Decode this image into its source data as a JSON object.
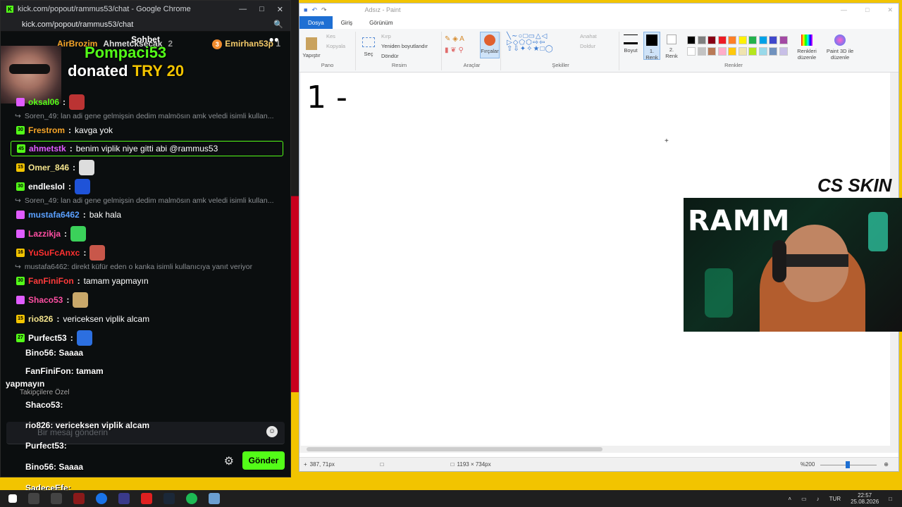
{
  "chrome": {
    "title": "kick.com/popout/rammus53/chat - Google Chrome",
    "url": "kick.com/popout/rammus53/chat"
  },
  "chat": {
    "header": "Sohbet",
    "pinned": [
      {
        "name": "AirBrozim"
      },
      {
        "name": "Ahmetcksecak",
        "count": "2"
      },
      {
        "name": "Emirhan53p",
        "count": "1",
        "rank": "3"
      }
    ],
    "donation": {
      "name": "Pompaci53",
      "text": "donated",
      "amount": "TRY 20",
      "mark": "!"
    },
    "messages": [
      {
        "type": "msg",
        "user": "oksal06",
        "text": "",
        "color": "#53fc18",
        "emote": "#b33"
      },
      {
        "type": "reply",
        "text": "Soren_49: lan adi gene gelmişsin dedim malmösın amk veledi isimli kullan..."
      },
      {
        "type": "msg",
        "lvl": "30",
        "user": "Frestrom",
        "text": "kavga yok",
        "color": "#f7a528"
      },
      {
        "type": "highlight",
        "lvl": "45",
        "user": "ahmetstk",
        "text": "benim viplik niye gitti abi @rammus53",
        "color": "#e05cff"
      },
      {
        "type": "msg",
        "lvl": "15",
        "user": "Omer_846",
        "text": "",
        "color": "#f3e38c",
        "emote": "#ddd"
      },
      {
        "type": "msg",
        "lvl": "30",
        "user": "endlesIol",
        "text": "",
        "color": "#ffffff",
        "emote": "#1f53d8"
      },
      {
        "type": "reply",
        "text": "Soren_49: lan adi gene gelmişsin dedim malmösın amk veledi isimli kullan..."
      },
      {
        "type": "msg",
        "lvl": "",
        "user": "mustafa6462",
        "text": "bak hala",
        "color": "#5aa0ff"
      },
      {
        "type": "msg",
        "lvl": "",
        "user": "Lazzikja",
        "text": "",
        "color": "#ff4fa3",
        "emote": "#3bd15a"
      },
      {
        "type": "msg",
        "lvl": "16",
        "user": "YuSuFcAnxc",
        "text": "",
        "color": "#ff3030",
        "emote": "#c8574a"
      },
      {
        "type": "reply",
        "text": "mustafa6462: direkt küfür eden o kanka isimli kullanıcıya yanıt veriyor"
      },
      {
        "type": "msg",
        "lvl": "30",
        "user": "FanFiniFon",
        "text": "tamam yapmayın",
        "color": "#ff3b3b"
      },
      {
        "type": "msg",
        "lvl": "",
        "user": "Shaco53",
        "text": "",
        "color": "#ff4fa3",
        "emote": "#c9a86a"
      },
      {
        "type": "msg",
        "lvl": "15",
        "user": "rio826",
        "text": "vericeksen viplik alcam",
        "color": "#f3e38c"
      },
      {
        "type": "msg",
        "lvl": "27",
        "user": "Purfect53",
        "text": "",
        "color": "#ffffff",
        "emote": "#2c6fe0"
      }
    ],
    "overlay_lines": [
      {
        "user": "Bino56",
        "text": "Saaaa"
      },
      {
        "user": "FanFiniFon",
        "text": "tamam"
      },
      {
        "user": "",
        "text": "yapmayın"
      },
      {
        "user": "",
        "text": "Takipçilere Özel"
      },
      {
        "user": "Shaco53",
        "text": ""
      },
      {
        "user": "rio826",
        "text": "vericeksen viplik alcam"
      },
      {
        "user": "Purfect53",
        "text": ""
      },
      {
        "user": "Bino56",
        "text": "Saaaa"
      },
      {
        "user": "SadeceEfe",
        "text": ""
      }
    ],
    "input_placeholder": "Bir mesaj gönderin",
    "send_label": "Gönder"
  },
  "paint": {
    "title": "Adsız - Paint",
    "tabs": [
      "Dosya",
      "Giriş",
      "Görünüm"
    ],
    "ribbon": {
      "clipboard": {
        "paste": "Yapıştır",
        "cut": "Kes",
        "copy": "Kopyala",
        "label": "Pano"
      },
      "image": {
        "select": "Seç",
        "crop": "Kırp",
        "resize": "Yeniden boyutlandır",
        "rotate": "Döndür",
        "label": "Resim"
      },
      "tools": {
        "brushes": "Fırçalar",
        "label": "Araçlar"
      },
      "shapes": {
        "outline": "Anahat",
        "fill": "Doldur",
        "label": "Şekiller"
      },
      "size": "Boyut",
      "color1": "1. Renk",
      "color2": "2. Renk",
      "colors_label": "Renkler",
      "edit_colors": "Renkleri düzenle",
      "paint3d": "Paint 3D ile düzenle"
    },
    "palette": [
      "#000000",
      "#7f7f7f",
      "#880015",
      "#ed1c24",
      "#ff7f27",
      "#fff200",
      "#22b14c",
      "#00a2e8",
      "#3f48cc",
      "#a349a4",
      "#ffffff",
      "#c3c3c3",
      "#b97a57",
      "#ffaec9",
      "#ffc90e",
      "#efe4b0",
      "#b5e61d",
      "#99d9ea",
      "#7092be",
      "#c8bfe7"
    ],
    "canvas_text": "1 -",
    "status": {
      "cursor": "387, 71px",
      "size": "1193 × 734px",
      "zoom": "%200"
    }
  },
  "overlay": {
    "brand": "CS SKIN",
    "webcam_text": "RAMM"
  },
  "taskbar": {
    "lang": "TUR",
    "time": "22:57",
    "date": "25.08.2026"
  }
}
